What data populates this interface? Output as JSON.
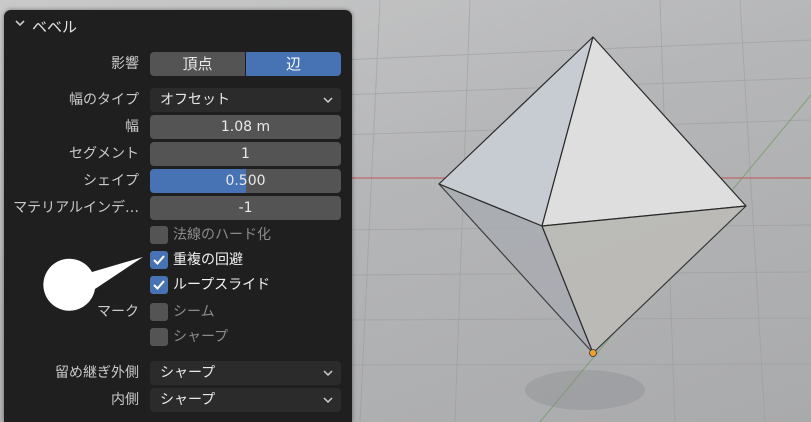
{
  "panel": {
    "title": "ベベル",
    "affect": {
      "label": "影響",
      "options": [
        "頂点",
        "辺"
      ],
      "selected": "辺"
    },
    "width_type": {
      "label": "幅のタイプ",
      "value": "オフセット"
    },
    "width": {
      "label": "幅",
      "value": "1.08 m"
    },
    "segments": {
      "label": "セグメント",
      "value": "1"
    },
    "shape": {
      "label": "シェイプ",
      "value": "0.500",
      "fill_fraction": 0.5
    },
    "material_index": {
      "label": "マテリアルインデ…",
      "value": "-1"
    },
    "checkboxes": [
      {
        "label": "法線のハード化",
        "checked": false
      },
      {
        "label": "重複の回避",
        "checked": true
      },
      {
        "label": "ループスライド",
        "checked": true
      }
    ],
    "mark": {
      "label": "マーク",
      "items": [
        {
          "label": "シーム",
          "checked": false
        },
        {
          "label": "シャープ",
          "checked": false
        }
      ]
    },
    "miter_outer": {
      "label": "留め継ぎ外側",
      "value": "シャープ"
    },
    "miter_inner": {
      "label": "内側",
      "value": "シャープ"
    }
  },
  "colors": {
    "accent": "#4772b3",
    "panel_bg": "#1f1f1f",
    "field_bg": "#545454",
    "vertex_highlight": "#f0a030"
  },
  "icons": {
    "header": "chevron-down-icon",
    "dropdown": "chevron-down-icon",
    "check": "checkmark-icon"
  }
}
